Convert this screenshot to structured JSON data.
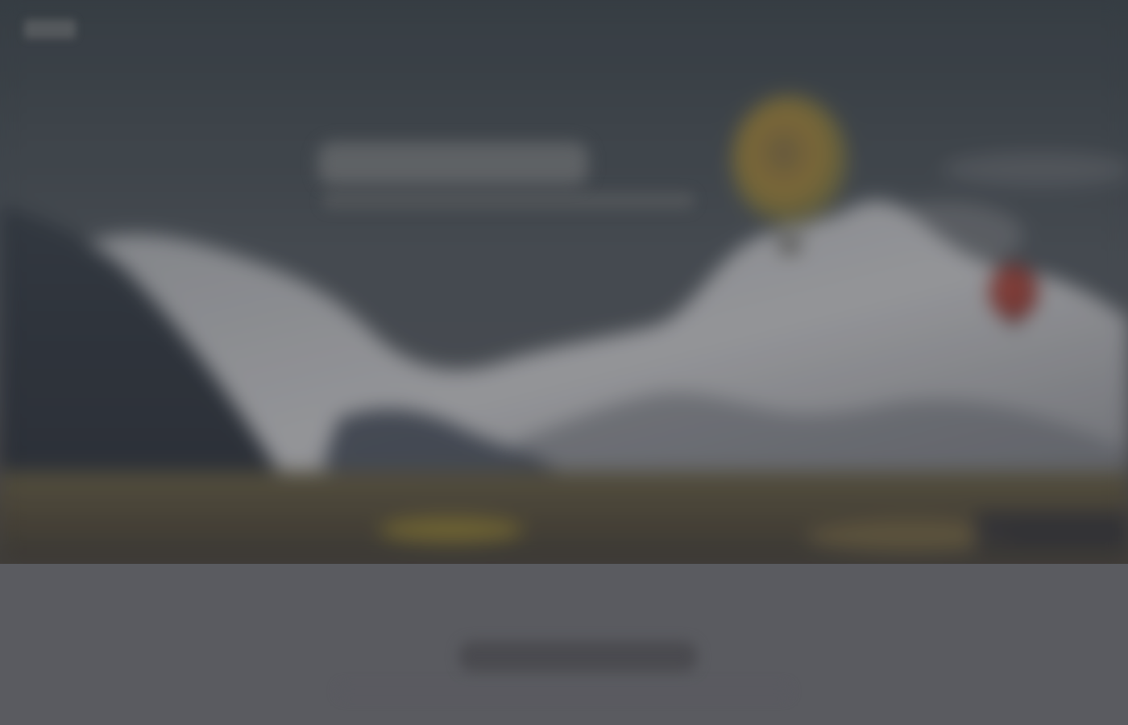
{
  "page": {
    "background_color": "#5a5b60"
  },
  "header": {
    "logo_text": "",
    "logo_color": "#808080"
  },
  "hero": {
    "title": "",
    "subtitle": "",
    "background_colors": {
      "sky_top": "#394147",
      "sky_mid": "#4a5056",
      "mountain_left": "#2f353d",
      "mountain_snow": "#9b9da0",
      "foreground": "#4a4538",
      "balloon_large": "#8b7339",
      "balloon_small": "#8a3732"
    }
  },
  "content": {
    "heading": "",
    "subtext": ""
  }
}
